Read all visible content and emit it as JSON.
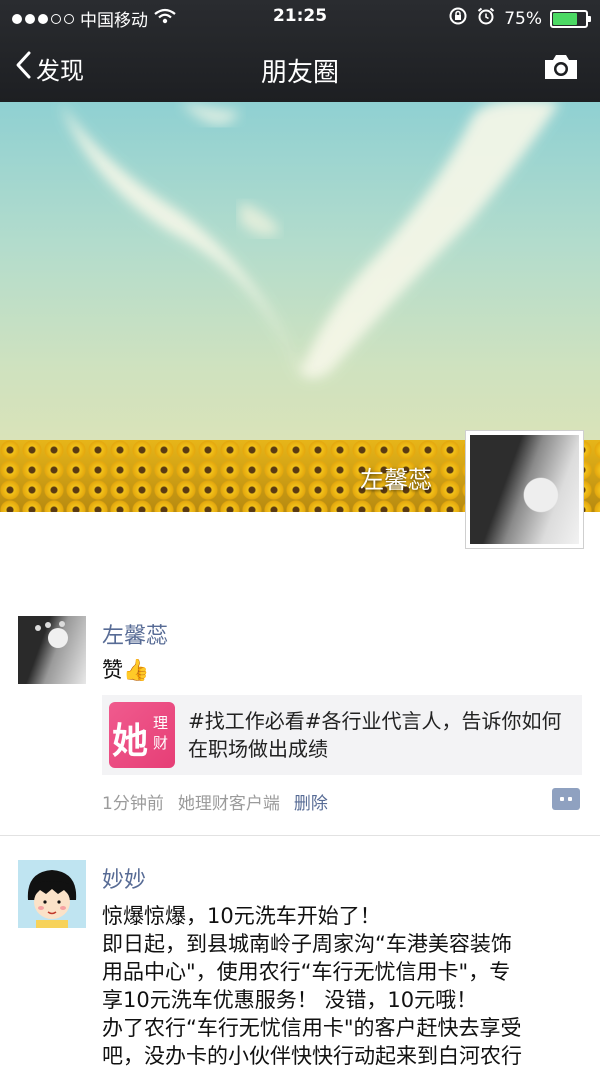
{
  "status_bar": {
    "carrier": "中国移动",
    "time": "21:25",
    "battery_percent": "75%",
    "battery_level": 0.75,
    "icons": [
      "signal-dots",
      "wifi-icon",
      "orientation-lock-icon",
      "alarm-icon",
      "battery-icon"
    ]
  },
  "nav": {
    "back_label": "发现",
    "title": "朋友圈",
    "right_icon": "camera-icon"
  },
  "cover": {
    "name": "左馨蕊"
  },
  "posts": [
    {
      "username": "左馨蕊",
      "text": "赞👍",
      "share": {
        "icon_big": "她",
        "icon_small_1": "理",
        "icon_small_2": "财",
        "text": "#找工作必看#各行业代言人，告诉你如何在职场做出成绩"
      },
      "time": "1分钟前",
      "source": "她理财客户端",
      "delete_label": "删除"
    },
    {
      "username": "妙妙",
      "lines": [
        "惊爆惊爆，10元洗车开始了！",
        "即日起，到县城南岭子周家沟“车港美容装饰",
        "用品中心\"，使用农行“车行无忧信用卡\"，专",
        "享10元洗车优惠服务！  没错，10元哦！",
        "办了农行“车行无忧信用卡\"的客户赶快去享受",
        "吧，没办卡的小伙伴快快行动起来到白河农行"
      ]
    }
  ],
  "colors": {
    "nav_bg": "#1d1f22",
    "link": "#576b95",
    "battery_green": "#4cd964",
    "app_icon_pink": "#e63e76"
  }
}
